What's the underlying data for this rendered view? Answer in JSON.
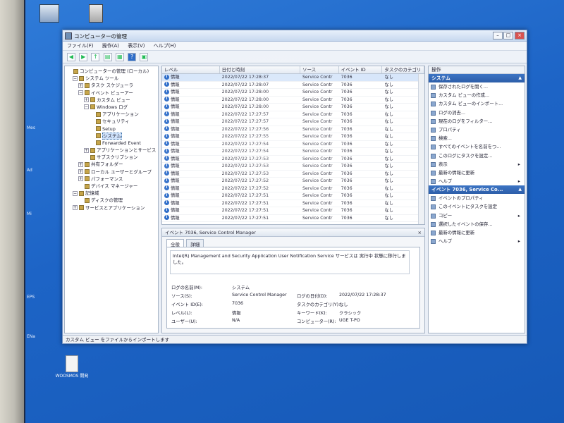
{
  "window": {
    "title": "コンピューターの管理",
    "menus": [
      "ファイル(F)",
      "操作(A)",
      "表示(V)",
      "ヘルプ(H)"
    ],
    "status": "カスタム ビュー をファイルからインポートします"
  },
  "desktop": {
    "icons": [
      {
        "label": ""
      },
      {
        "label": ""
      },
      {
        "label": "WOOSMOS 開発"
      }
    ],
    "edge_labels": [
      "Mes",
      "Ad",
      "Mi",
      "EPS",
      "ENa"
    ]
  },
  "tree": {
    "nodes": [
      {
        "label": "コンピューターの管理 (ローカル)",
        "exp": "",
        "level": 0
      },
      {
        "label": "システム ツール",
        "exp": "−",
        "level": 1
      },
      {
        "label": "タスク スケジューラ",
        "exp": "+",
        "level": 2
      },
      {
        "label": "イベント ビューアー",
        "exp": "−",
        "level": 2
      },
      {
        "label": "カスタム ビュー",
        "exp": "+",
        "level": 3
      },
      {
        "label": "Windows ログ",
        "exp": "−",
        "level": 3
      },
      {
        "label": "アプリケーション",
        "exp": "",
        "level": 4
      },
      {
        "label": "セキュリティ",
        "exp": "",
        "level": 4
      },
      {
        "label": "Setup",
        "exp": "",
        "level": 4
      },
      {
        "label": "システム",
        "exp": "",
        "level": 4,
        "selected": true
      },
      {
        "label": "Forwarded Event",
        "exp": "",
        "level": 4
      },
      {
        "label": "アプリケーションとサービス",
        "exp": "+",
        "level": 3
      },
      {
        "label": "サブスクリプション",
        "exp": "",
        "level": 3
      },
      {
        "label": "共有フォルダー",
        "exp": "+",
        "level": 2
      },
      {
        "label": "ローカル ユーザーとグループ",
        "exp": "+",
        "level": 2
      },
      {
        "label": "パフォーマンス",
        "exp": "+",
        "level": 2
      },
      {
        "label": "デバイス マネージャー",
        "exp": "",
        "level": 2
      },
      {
        "label": "記憶域",
        "exp": "−",
        "level": 1
      },
      {
        "label": "ディスクの管理",
        "exp": "",
        "level": 2
      },
      {
        "label": "サービスとアプリケーション",
        "exp": "+",
        "level": 1
      }
    ]
  },
  "events": {
    "columns": [
      "レベル",
      "日付と時刻",
      "ソース",
      "イベント ID",
      "タスクのカテゴリ"
    ],
    "rows": [
      {
        "level": "情報",
        "time": "2022/07/22 17:28:37",
        "source": "Service Contr",
        "id": "7036",
        "cat": "なし"
      },
      {
        "level": "情報",
        "time": "2022/07/22 17:28:07",
        "source": "Service Contr",
        "id": "7036",
        "cat": "なし"
      },
      {
        "level": "情報",
        "time": "2022/07/22 17:28:00",
        "source": "Service Contr",
        "id": "7036",
        "cat": "なし"
      },
      {
        "level": "情報",
        "time": "2022/07/22 17:28:00",
        "source": "Service Contr",
        "id": "7036",
        "cat": "なし"
      },
      {
        "level": "情報",
        "time": "2022/07/22 17:28:00",
        "source": "Service Contr",
        "id": "7036",
        "cat": "なし"
      },
      {
        "level": "情報",
        "time": "2022/07/22 17:27:57",
        "source": "Service Contr",
        "id": "7036",
        "cat": "なし"
      },
      {
        "level": "情報",
        "time": "2022/07/22 17:27:57",
        "source": "Service Contr",
        "id": "7036",
        "cat": "なし"
      },
      {
        "level": "情報",
        "time": "2022/07/22 17:27:56",
        "source": "Service Contr",
        "id": "7036",
        "cat": "なし"
      },
      {
        "level": "情報",
        "time": "2022/07/22 17:27:55",
        "source": "Service Contr",
        "id": "7036",
        "cat": "なし"
      },
      {
        "level": "情報",
        "time": "2022/07/22 17:27:54",
        "source": "Service Contr",
        "id": "7036",
        "cat": "なし"
      },
      {
        "level": "情報",
        "time": "2022/07/22 17:27:54",
        "source": "Service Contr",
        "id": "7036",
        "cat": "なし"
      },
      {
        "level": "情報",
        "time": "2022/07/22 17:27:53",
        "source": "Service Contr",
        "id": "7036",
        "cat": "なし"
      },
      {
        "level": "情報",
        "time": "2022/07/22 17:27:53",
        "source": "Service Contr",
        "id": "7036",
        "cat": "なし"
      },
      {
        "level": "情報",
        "time": "2022/07/22 17:27:53",
        "source": "Service Contr",
        "id": "7036",
        "cat": "なし"
      },
      {
        "level": "情報",
        "time": "2022/07/22 17:27:52",
        "source": "Service Contr",
        "id": "7036",
        "cat": "なし"
      },
      {
        "level": "情報",
        "time": "2022/07/22 17:27:52",
        "source": "Service Contr",
        "id": "7036",
        "cat": "なし"
      },
      {
        "level": "情報",
        "time": "2022/07/22 17:27:51",
        "source": "Service Contr",
        "id": "7036",
        "cat": "なし"
      },
      {
        "level": "情報",
        "time": "2022/07/22 17:27:51",
        "source": "Service Contr",
        "id": "7036",
        "cat": "なし"
      },
      {
        "level": "情報",
        "time": "2022/07/22 17:27:51",
        "source": "Service Contr",
        "id": "7036",
        "cat": "なし"
      },
      {
        "level": "情報",
        "time": "2022/07/22 17:27:51",
        "source": "Service Contr",
        "id": "7036",
        "cat": "なし"
      }
    ]
  },
  "detail": {
    "title": "イベント 7036, Service Control Manager",
    "tabs": [
      "全般",
      "詳細"
    ],
    "message": "Intel(R) Management and Security Application User Notification Service サービスは 実行中 状態に移行しました。",
    "fields": [
      {
        "label": "ログの名前(M):",
        "value": "システム"
      },
      {
        "label": "ソース(S):",
        "value": "Service Control Manager"
      },
      {
        "label": "ログの日付(D):",
        "value": "2022/07/22 17:28:37"
      },
      {
        "label": "イベント ID(E):",
        "value": "7036"
      },
      {
        "label": "タスクのカテゴリ(Y):",
        "value": "なし"
      },
      {
        "label": "レベル(L):",
        "value": "情報"
      },
      {
        "label": "キーワード(K):",
        "value": "クラシック"
      },
      {
        "label": "ユーザー(U):",
        "value": "N/A"
      },
      {
        "label": "コンピューター(R):",
        "value": "UGE T-PO"
      }
    ]
  },
  "actions": {
    "header": "操作",
    "section1": "システム",
    "items1": [
      "保存されたログを開く...",
      "カスタム ビューの作成...",
      "カスタム ビューのインポート...",
      "ログの消去...",
      "現在のログをフィルター...",
      "プロパティ",
      "検索...",
      "すべてのイベントを名前をつ...",
      "このログにタスクを設定...",
      "表示",
      "最新の情報に更新",
      "ヘルプ"
    ],
    "section2": "イベント 7036, Service Co...",
    "items2": [
      "イベントのプロパティ",
      "このイベントにタスクを設定",
      "コピー",
      "選択したイベントの保存...",
      "最新の情報に更新",
      "ヘルプ"
    ]
  },
  "colors": {
    "accent": "#2d5ea9",
    "desktop": "#1d64c6"
  }
}
